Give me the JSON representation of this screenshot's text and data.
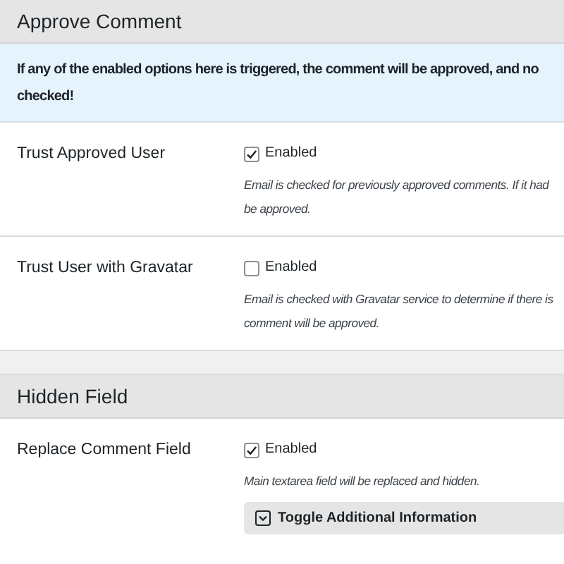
{
  "sections": [
    {
      "title": "Approve Comment",
      "notice": [
        "If any of the enabled options here is triggered, the comment will be approved, and no",
        "checked!"
      ],
      "options": [
        {
          "label": "Trust Approved User",
          "checkbox": "Enabled",
          "checked": true,
          "description": [
            "Email is checked for previously approved comments. If it had",
            "be approved."
          ]
        },
        {
          "label": "Trust User with Gravatar",
          "checkbox": "Enabled",
          "checked": false,
          "description": [
            "Email is checked with Gravatar service to determine if there is",
            "comment will be approved."
          ]
        }
      ]
    },
    {
      "title": "Hidden Field",
      "options": [
        {
          "label": "Replace Comment Field",
          "checkbox": "Enabled",
          "checked": true,
          "description": [
            "Main textarea field will be replaced and hidden."
          ],
          "toggle": "Toggle Additional Information"
        }
      ]
    }
  ]
}
